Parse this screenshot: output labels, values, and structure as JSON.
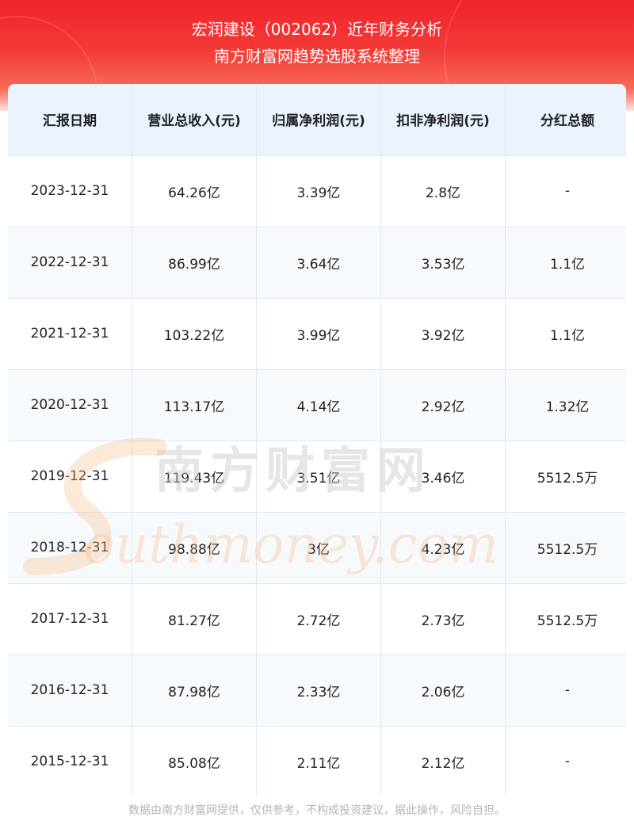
{
  "header": {
    "title": "宏润建设（002062）近年财务分析",
    "subtitle": "南方财富网趋势选股系统整理"
  },
  "table": {
    "columns": [
      "汇报日期",
      "营业总收入(元)",
      "归属净利润(元)",
      "扣非净利润(元)",
      "分红总额"
    ],
    "rows": [
      [
        "2023-12-31",
        "64.26亿",
        "3.39亿",
        "2.8亿",
        "-"
      ],
      [
        "2022-12-31",
        "86.99亿",
        "3.64亿",
        "3.53亿",
        "1.1亿"
      ],
      [
        "2021-12-31",
        "103.22亿",
        "3.99亿",
        "3.92亿",
        "1.1亿"
      ],
      [
        "2020-12-31",
        "113.17亿",
        "4.14亿",
        "2.92亿",
        "1.32亿"
      ],
      [
        "2019-12-31",
        "119.43亿",
        "3.51亿",
        "3.46亿",
        "5512.5万"
      ],
      [
        "2018-12-31",
        "98.88亿",
        "3亿",
        "4.23亿",
        "5512.5万"
      ],
      [
        "2017-12-31",
        "81.27亿",
        "2.72亿",
        "2.73亿",
        "5512.5万"
      ],
      [
        "2016-12-31",
        "87.98亿",
        "2.33亿",
        "2.06亿",
        "-"
      ],
      [
        "2015-12-31",
        "85.08亿",
        "2.11亿",
        "2.12亿",
        "-"
      ]
    ]
  },
  "watermark": {
    "cn": "南方财富网",
    "en": "outhmoney.com"
  },
  "footer": {
    "disclaimer": "数据由南方财富网提供，仅供参考，不构成投资建议，据此操作，风险自担。"
  },
  "colors": {
    "header_red": "#f0242c",
    "table_head_bg": "#eaf3fe",
    "grid_line": "#dfe8f3",
    "watermark_orange": "#f5c08c"
  }
}
